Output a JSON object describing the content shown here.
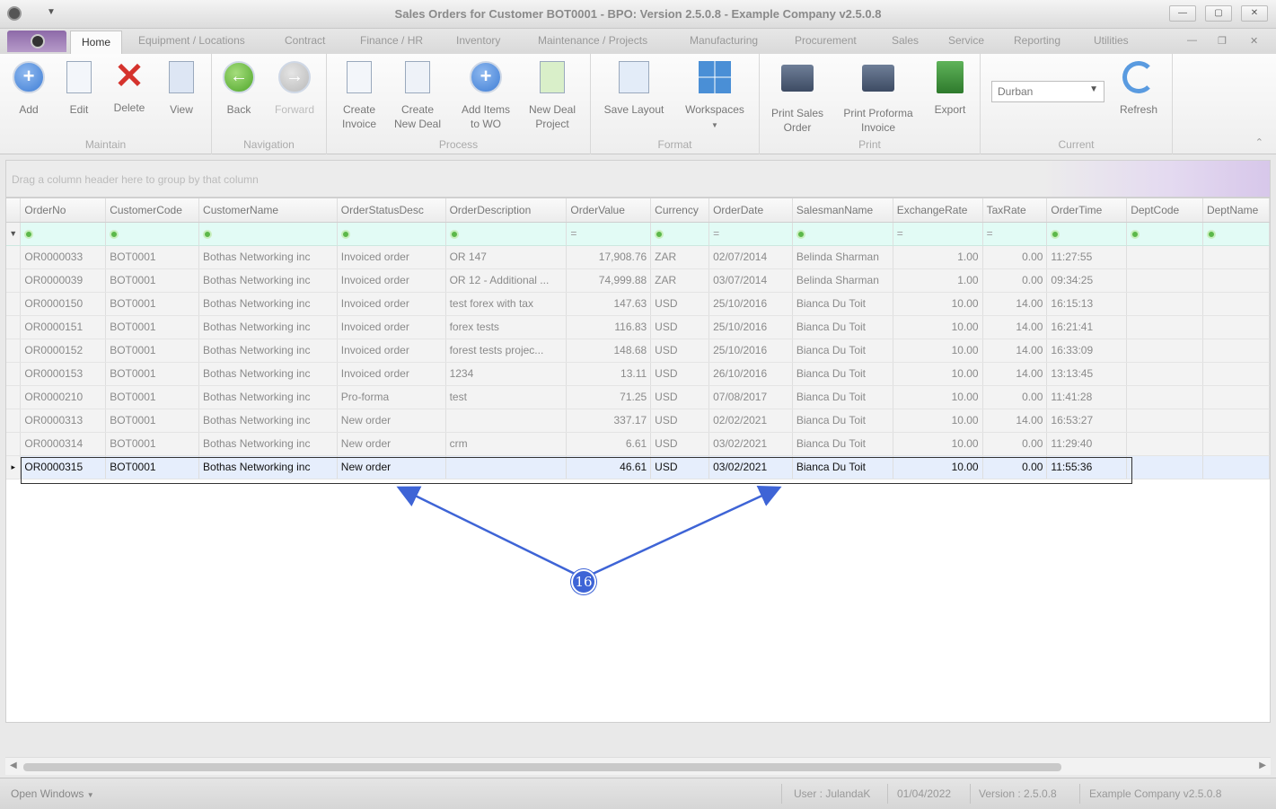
{
  "window": {
    "title": "Sales Orders for Customer BOT0001 - BPO: Version 2.5.0.8 - Example Company v2.5.0.8"
  },
  "menu_tabs": [
    "Home",
    "Equipment / Locations",
    "Contract",
    "Finance / HR",
    "Inventory",
    "Maintenance / Projects",
    "Manufacturing",
    "Procurement",
    "Sales",
    "Service",
    "Reporting",
    "Utilities"
  ],
  "ribbon": {
    "maintain": {
      "label": "Maintain",
      "add": "Add",
      "edit": "Edit",
      "delete": "Delete",
      "view": "View"
    },
    "navigation": {
      "label": "Navigation",
      "back": "Back",
      "forward": "Forward"
    },
    "process": {
      "label": "Process",
      "create_invoice_1": "Create",
      "create_invoice_2": "Invoice",
      "create_deal_1": "Create",
      "create_deal_2": "New Deal",
      "add_items_1": "Add Items",
      "add_items_2": "to WO",
      "new_deal_1": "New Deal",
      "new_deal_2": "Project"
    },
    "format": {
      "label": "Format",
      "save_layout": "Save Layout",
      "workspaces": "Workspaces"
    },
    "print": {
      "label": "Print",
      "print_sales_1": "Print Sales",
      "print_sales_2": "Order",
      "print_proforma_1": "Print Proforma",
      "print_proforma_2": "Invoice",
      "export": "Export"
    },
    "current": {
      "label": "Current",
      "branch": "Durban",
      "refresh": "Refresh"
    }
  },
  "group_panel_hint": "Drag a column header here to group by that column",
  "grid": {
    "columns": [
      "OrderNo",
      "CustomerCode",
      "CustomerName",
      "OrderStatusDesc",
      "OrderDescription",
      "OrderValue",
      "Currency",
      "OrderDate",
      "SalesmanName",
      "ExchangeRate",
      "TaxRate",
      "OrderTime",
      "DeptCode",
      "DeptName"
    ],
    "rows": [
      [
        "OR0000033",
        "BOT0001",
        "Bothas Networking inc",
        "Invoiced order",
        "OR 147",
        "17,908.76",
        "ZAR",
        "02/07/2014",
        "Belinda Sharman",
        "1.00",
        "0.00",
        "11:27:55",
        "",
        ""
      ],
      [
        "OR0000039",
        "BOT0001",
        "Bothas Networking inc",
        "Invoiced order",
        "OR 12 - Additional ...",
        "74,999.88",
        "ZAR",
        "03/07/2014",
        "Belinda Sharman",
        "1.00",
        "0.00",
        "09:34:25",
        "",
        ""
      ],
      [
        "OR0000150",
        "BOT0001",
        "Bothas Networking inc",
        "Invoiced order",
        "test forex with tax",
        "147.63",
        "USD",
        "25/10/2016",
        "Bianca Du Toit",
        "10.00",
        "14.00",
        "16:15:13",
        "",
        ""
      ],
      [
        "OR0000151",
        "BOT0001",
        "Bothas Networking inc",
        "Invoiced order",
        "forex tests",
        "116.83",
        "USD",
        "25/10/2016",
        "Bianca Du Toit",
        "10.00",
        "14.00",
        "16:21:41",
        "",
        ""
      ],
      [
        "OR0000152",
        "BOT0001",
        "Bothas Networking inc",
        "Invoiced order",
        "forest tests projec...",
        "148.68",
        "USD",
        "25/10/2016",
        "Bianca Du Toit",
        "10.00",
        "14.00",
        "16:33:09",
        "",
        ""
      ],
      [
        "OR0000153",
        "BOT0001",
        "Bothas Networking inc",
        "Invoiced order",
        "1234",
        "13.11",
        "USD",
        "26/10/2016",
        "Bianca Du Toit",
        "10.00",
        "14.00",
        "13:13:45",
        "",
        ""
      ],
      [
        "OR0000210",
        "BOT0001",
        "Bothas Networking inc",
        "Pro-forma",
        "test",
        "71.25",
        "USD",
        "07/08/2017",
        "Bianca Du Toit",
        "10.00",
        "0.00",
        "11:41:28",
        "",
        ""
      ],
      [
        "OR0000313",
        "BOT0001",
        "Bothas Networking inc",
        "New order",
        "",
        "337.17",
        "USD",
        "02/02/2021",
        "Bianca Du Toit",
        "10.00",
        "14.00",
        "16:53:27",
        "",
        ""
      ],
      [
        "OR0000314",
        "BOT0001",
        "Bothas Networking inc",
        "New order",
        "crm",
        "6.61",
        "USD",
        "03/02/2021",
        "Bianca Du Toit",
        "10.00",
        "0.00",
        "11:29:40",
        "",
        ""
      ],
      [
        "OR0000315",
        "BOT0001",
        "Bothas Networking inc",
        "New order",
        "",
        "46.61",
        "USD",
        "03/02/2021",
        "Bianca Du Toit",
        "10.00",
        "0.00",
        "11:55:36",
        "",
        ""
      ]
    ],
    "selected_row": 9
  },
  "callout": {
    "number": "16"
  },
  "status": {
    "open_windows": "Open Windows",
    "user": "User : JulandaK",
    "date": "01/04/2022",
    "version": "Version : 2.5.0.8",
    "company": "Example Company v2.5.0.8"
  },
  "colors": {
    "accent": "#3e64d6",
    "selection": "#e6eefc",
    "filter_row": "#e2fbf5"
  }
}
